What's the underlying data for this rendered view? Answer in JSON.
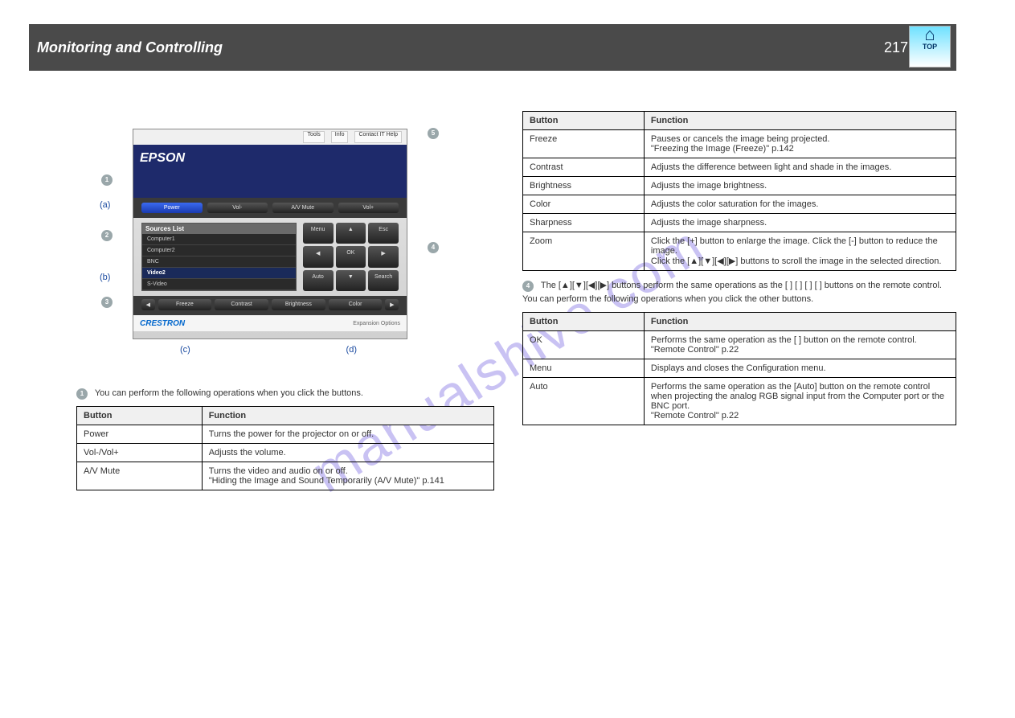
{
  "header": {
    "title": "Monitoring and Controlling",
    "page": "217"
  },
  "top_icon": {
    "label": "TOP"
  },
  "watermark": "manualshive.com",
  "screenshot": {
    "brand": "EPSON",
    "topbar": [
      "Tools",
      "Info",
      "Contact IT Help"
    ],
    "row1": [
      {
        "label": "Power",
        "active": true
      },
      {
        "label": "Vol-"
      },
      {
        "label": "A/V Mute"
      },
      {
        "label": "Vol+"
      }
    ],
    "sources_title": "Sources List",
    "sources": [
      {
        "name": "Computer1",
        "meta": ""
      },
      {
        "name": "Computer2",
        "meta": ""
      },
      {
        "name": "BNC",
        "meta": ""
      },
      {
        "name": "Video2",
        "meta": "",
        "selected": true
      },
      {
        "name": "S-Video",
        "meta": ""
      }
    ],
    "remote_buttons": [
      "Menu",
      "▲",
      "Esc",
      "◀",
      "OK",
      "▶",
      "Auto",
      "▼",
      "Search"
    ],
    "bottom_row": [
      "Freeze",
      "Contrast",
      "Brightness",
      "Color"
    ],
    "footer_left": "CRESTRON",
    "footer_right": "Expansion Options",
    "bottom_arrows": {
      "c_left": "◀",
      "d_right": "▶"
    }
  },
  "callouts": {
    "n1": "1",
    "n2": "2",
    "n3": "3",
    "n4": "4",
    "n5": "5",
    "a": "(a)",
    "b": "(b)",
    "c": "(c)",
    "d": "(d)"
  },
  "left_intro": "You can perform the following operations when you click the buttons.",
  "table1": {
    "header": [
      "Button",
      "Function"
    ],
    "rows": [
      [
        "Power",
        "Turns the power for the projector on or off."
      ],
      [
        "Vol-/Vol+",
        "Adjusts the volume."
      ],
      [
        "A/V Mute",
        "Turns the video and audio on or off.\n\"Hiding the Image and Sound Temporarily (A/V Mute)\" p.141"
      ]
    ]
  },
  "right_col": {
    "section4_lead": "You can perform the following operations when you click the buttons.",
    "table4": {
      "header": [
        "Button",
        "Function"
      ],
      "rows": [
        [
          "Freeze",
          "Pauses or cancels the image being projected.\n\"Freezing the Image (Freeze)\" p.142"
        ],
        [
          "Contrast",
          "Adjusts the difference between light and shade in the images."
        ],
        [
          "Brightness",
          "Adjusts the image brightness."
        ],
        [
          "Color",
          "Adjusts the color saturation for the images."
        ],
        [
          "Sharpness",
          "Adjusts the image sharpness."
        ],
        [
          "Zoom",
          "Click the [+] button to enlarge the image. Click the [-] button to reduce the image.\nClick the [▲][▼][◀][▶] buttons to scroll the image in the selected direction."
        ]
      ]
    },
    "para5": "The [▲][▼][◀][▶] buttons perform the same operations as the [ ] [ ] [ ] [ ] buttons on the remote control. You can perform the following operations when you click the other buttons.",
    "table5": {
      "header": [
        "Button",
        "Function"
      ],
      "rows": [
        [
          "OK",
          "Performs the same operation as the [ ] button on the remote control.\n\"Remote Control\" p.22"
        ],
        [
          "Menu",
          "Displays and closes the Configuration menu."
        ],
        [
          "Auto",
          "Performs the same operation as the [Auto] button on the remote control when projecting the analog RGB signal input from the Computer port or the BNC port.\n\"Remote Control\" p.22"
        ]
      ]
    }
  }
}
